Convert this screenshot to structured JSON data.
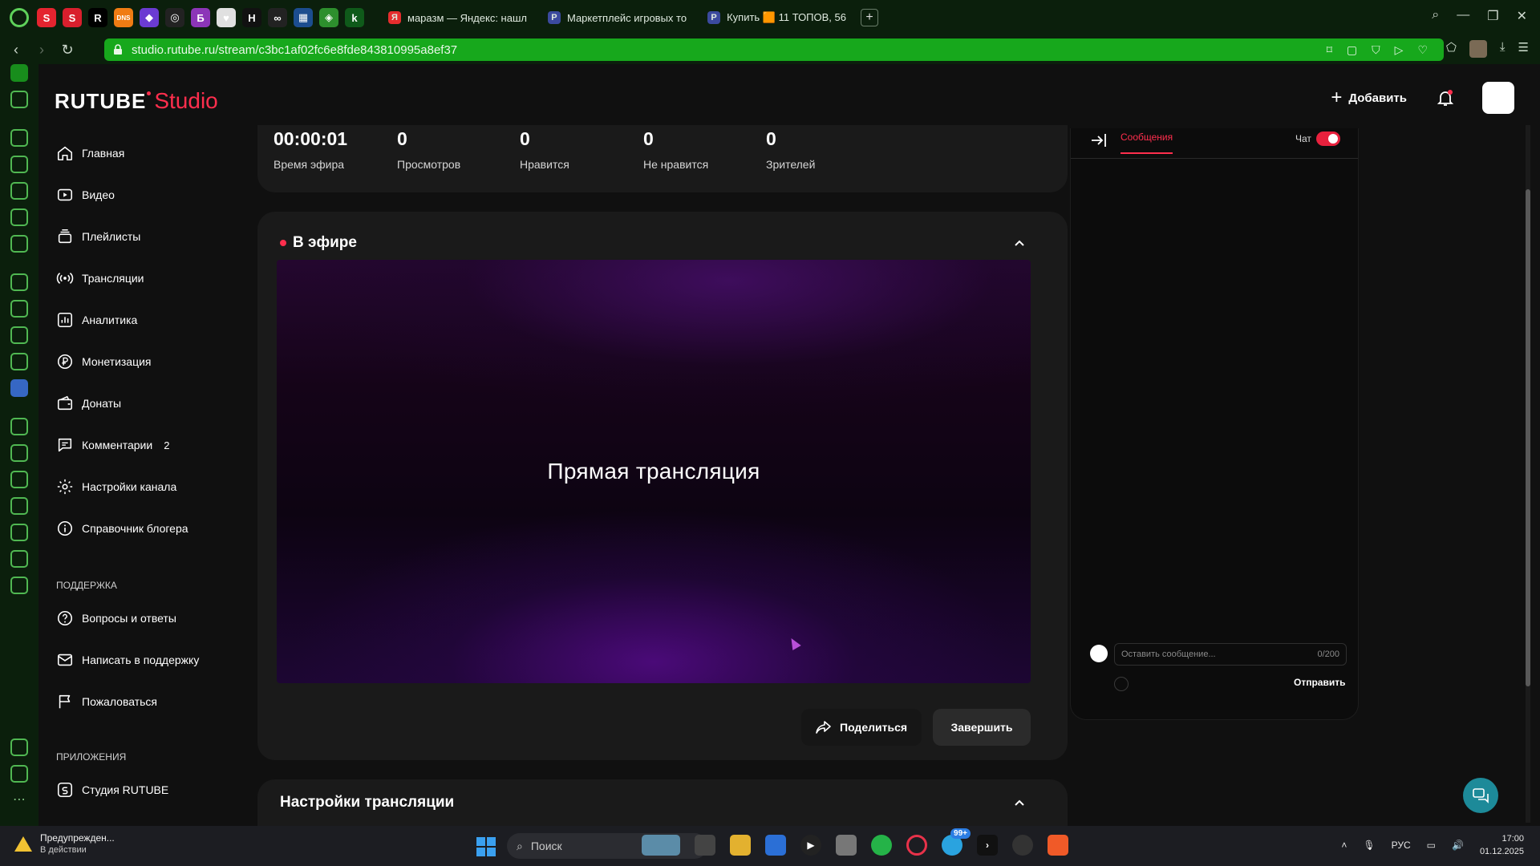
{
  "browser": {
    "pinned_tabs": [
      {
        "name": "s-red-icon",
        "glyph": "S",
        "color": "#e4242f"
      },
      {
        "name": "s-red-active-icon",
        "glyph": "S",
        "color": "#d91f2d"
      },
      {
        "name": "r-icon",
        "glyph": "R",
        "color": "#000000"
      },
      {
        "name": "dns-icon",
        "glyph": "DNS",
        "color": "#f07c13"
      },
      {
        "name": "puzzle-icon",
        "glyph": "◆",
        "color": "#6b3bd2"
      },
      {
        "name": "steam-icon",
        "glyph": "◎",
        "color": "#222222"
      },
      {
        "name": "b-icon",
        "glyph": "Б",
        "color": "#8c35b8"
      },
      {
        "name": "heart-shield-icon",
        "glyph": "♥",
        "color": "#e0e0e0"
      },
      {
        "name": "h-icon",
        "glyph": "H",
        "color": "#111111"
      },
      {
        "name": "infinity-icon",
        "glyph": "∞",
        "color": "#222222"
      },
      {
        "name": "grid-icon",
        "glyph": "▦",
        "color": "#1c4d8f"
      },
      {
        "name": "leaf-icon",
        "glyph": "◈",
        "color": "#2d8f2d"
      },
      {
        "name": "k-icon",
        "glyph": "k",
        "color": "#0f5a1a"
      }
    ],
    "tabs": [
      {
        "title": "маразм — Яндекс: нашл",
        "fav": "Я",
        "fav_color": "#e52d2d"
      },
      {
        "title": "Маркетплейс игровых то",
        "fav": "P",
        "fav_color": "#3b4a9e"
      },
      {
        "title": "Купить 🟧 11 ТОПОВ, 56",
        "fav": "P",
        "fav_color": "#3b4a9e"
      }
    ],
    "url": "studio.rutube.ru/stream/c3bc1af02fc6e8fde843810995a8ef37"
  },
  "header": {
    "logo_main": "RUTUBE",
    "logo_studio": "Studio",
    "add_label": "Добавить"
  },
  "sidebar": {
    "items": [
      {
        "label": "Главная",
        "icon": "home-icon"
      },
      {
        "label": "Видео",
        "icon": "video-icon"
      },
      {
        "label": "Плейлисты",
        "icon": "playlist-icon"
      },
      {
        "label": "Трансляции",
        "icon": "broadcast-icon"
      },
      {
        "label": "Аналитика",
        "icon": "analytics-icon"
      },
      {
        "label": "Монетизация",
        "icon": "ruble-icon"
      },
      {
        "label": "Донаты",
        "icon": "wallet-icon"
      },
      {
        "label": "Комментарии",
        "icon": "comment-icon",
        "badge": "2"
      },
      {
        "label": "Настройки канала",
        "icon": "gear-icon"
      },
      {
        "label": "Справочник блогера",
        "icon": "info-icon"
      }
    ],
    "support_heading": "ПОДДЕРЖКА",
    "support_items": [
      {
        "label": "Вопросы и ответы",
        "icon": "question-icon"
      },
      {
        "label": "Написать в поддержку",
        "icon": "mail-icon"
      },
      {
        "label": "Пожаловаться",
        "icon": "flag-icon"
      }
    ],
    "apps_heading": "ПРИЛОЖЕНИЯ",
    "apps_items": [
      {
        "label": "Студия RUTUBE",
        "icon": "studio-app-icon"
      }
    ]
  },
  "stats": [
    {
      "value": "00:00:01",
      "label": "Время эфира"
    },
    {
      "value": "0",
      "label": "Просмотров"
    },
    {
      "value": "0",
      "label": "Нравится"
    },
    {
      "value": "0",
      "label": "Не нравится"
    },
    {
      "value": "0",
      "label": "Зрителей"
    }
  ],
  "live": {
    "title": "В эфире",
    "player_text": "Прямая трансляция",
    "share_label": "Поделиться",
    "finish_label": "Завершить"
  },
  "settings": {
    "title": "Настройки трансляции"
  },
  "chat": {
    "tab_label": "Сообщения",
    "toggle_label": "Чат",
    "input_placeholder": "Оставить сообщение...",
    "counter": "0/200",
    "send_label": "Отправить"
  },
  "taskbar": {
    "notification_title": "Предупрежден...",
    "notification_sub": "В действии",
    "search_placeholder": "Поиск",
    "telegram_badge": "99+",
    "language": "РУС",
    "time": "17:00",
    "date": "01.12.2025"
  },
  "colors": {
    "accent": "#ff2e4d",
    "opera_green": "#17a81c",
    "page_bg": "#101010",
    "card_bg": "#1a1a1a"
  }
}
